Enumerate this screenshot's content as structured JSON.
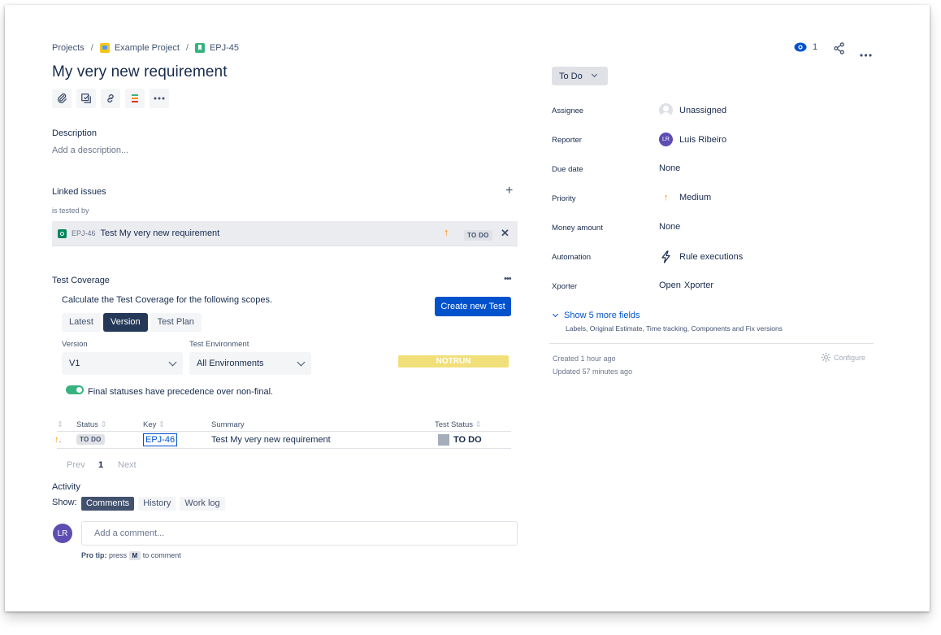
{
  "breadcrumb": {
    "projects": "Projects",
    "separator": "/",
    "project": "Example Project",
    "issue_key": "EPJ-45"
  },
  "issue": {
    "title": "My very new requirement"
  },
  "toolbar_icons": [
    "paperclip-icon",
    "checklist-icon",
    "link-icon",
    "xray-icon",
    "more-icon"
  ],
  "description": {
    "label": "Description",
    "placeholder": "Add a description..."
  },
  "linked_issues": {
    "label": "Linked issues",
    "relation": "is tested by",
    "item": {
      "key": "EPJ-46",
      "summary": "Test My very new requirement",
      "status": "TO DO"
    }
  },
  "test_coverage": {
    "label": "Test Coverage",
    "instructions": "Calculate the Test Coverage for the following scopes.",
    "create_button": "Create new Test",
    "scopes": [
      "Latest",
      "Version",
      "Test Plan"
    ],
    "active_scope": "Version",
    "version_label": "Version",
    "version_value": "V1",
    "environment_label": "Test Environment",
    "environment_value": "All Environments",
    "coverage_status": "NOTRUN",
    "toggle_on": true,
    "toggle_label": "Final statuses have precedence over non-final.",
    "columns": {
      "status": "Status",
      "key": "Key",
      "summary": "Summary",
      "test_status": "Test Status"
    },
    "rows": [
      {
        "priority_glyph": "↑",
        "status": "TO DO",
        "key": "EPJ-46",
        "summary": "Test My very new requirement",
        "test_status": "TO DO"
      }
    ],
    "pager": {
      "prev": "Prev",
      "page": "1",
      "next": "Next"
    }
  },
  "activity": {
    "label": "Activity",
    "show_label": "Show:",
    "tabs": [
      "Comments",
      "History",
      "Work log"
    ],
    "active_tab": "Comments",
    "avatar_initials": "LR",
    "comment_placeholder": "Add a comment...",
    "pro_tip_label": "Pro tip:",
    "pro_tip_press": "press",
    "pro_tip_key": "M",
    "pro_tip_rest": "to comment"
  },
  "header_actions": {
    "watchers": "1"
  },
  "status_button": "To Do",
  "fields": {
    "assignee_label": "Assignee",
    "assignee_value": "Unassigned",
    "reporter_label": "Reporter",
    "reporter_value": "Luis Ribeiro",
    "reporter_initials": "LR",
    "due_label": "Due date",
    "due_value": "None",
    "priority_label": "Priority",
    "priority_value": "Medium",
    "money_label": "Money amount",
    "money_value": "None",
    "automation_label": "Automation",
    "automation_value": "Rule executions",
    "xporter_label": "Xporter",
    "xporter_value_1": "Open",
    "xporter_value_2": "Xporter",
    "show_more": "Show 5 more fields",
    "show_more_sub": "Labels, Original Estimate, Time tracking, Components and Fix versions"
  },
  "meta": {
    "created": "Created 1 hour ago",
    "updated": "Updated 57 minutes ago",
    "configure": "Configure"
  },
  "colors": {
    "primary": "#0052cc",
    "dark_nav": "#253858",
    "success": "#36b37e",
    "priority_orange": "#ff8b00",
    "notrun": "#f1e07a"
  }
}
